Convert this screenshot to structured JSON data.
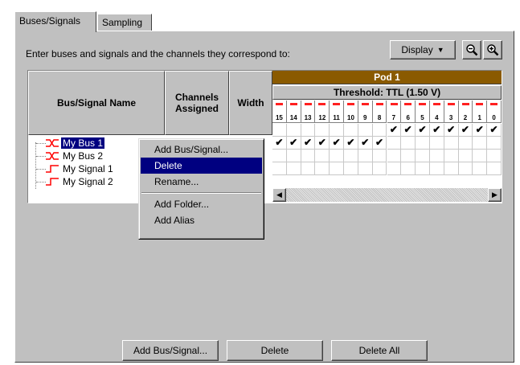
{
  "tabs": [
    {
      "label": "Buses/Signals",
      "active": true
    },
    {
      "label": "Sampling",
      "active": false
    }
  ],
  "instruction": "Enter buses and signals and the channels they correspond to:",
  "toolbar": {
    "display_label": "Display",
    "zoom_out_icon": "zoom-out-icon",
    "zoom_in_icon": "zoom-in-icon"
  },
  "grid": {
    "columns": {
      "name": "Bus/Signal Name",
      "channels": "Channels Assigned",
      "width": "Width"
    },
    "pod": {
      "label": "Pod 1",
      "threshold": "Threshold: TTL (1.50 V)",
      "channels": [
        "15",
        "14",
        "13",
        "12",
        "11",
        "10",
        "9",
        "8",
        "7",
        "6",
        "5",
        "4",
        "3",
        "2",
        "1",
        "0"
      ]
    },
    "rows": [
      {
        "name": "My Bus 1",
        "type": "bus",
        "selected": true,
        "assigned": [
          "7",
          "6",
          "5",
          "4",
          "3",
          "2",
          "1",
          "0"
        ]
      },
      {
        "name": "My Bus 2",
        "type": "bus",
        "selected": false,
        "assigned": [
          "15",
          "14",
          "13",
          "12",
          "11",
          "10",
          "9",
          "8"
        ]
      },
      {
        "name": "My Signal 1",
        "type": "signal",
        "selected": false,
        "assigned": []
      },
      {
        "name": "My Signal 2",
        "type": "signal",
        "selected": false,
        "assigned": []
      }
    ],
    "check_glyph": "✔"
  },
  "context_menu": {
    "items": [
      {
        "label": "Add Bus/Signal...",
        "highlighted": false
      },
      {
        "label": "Delete",
        "highlighted": true
      },
      {
        "label": "Rename...",
        "highlighted": false
      },
      {
        "separator": true
      },
      {
        "label": "Add Folder...",
        "highlighted": false
      },
      {
        "label": "Add Alias",
        "highlighted": false
      }
    ]
  },
  "buttons": {
    "add": "Add Bus/Signal...",
    "delete": "Delete",
    "delete_all": "Delete All"
  },
  "colors": {
    "pod_bar": "#8a5a00",
    "selection": "#000080",
    "threshold_dash": "#ff2020",
    "bus_icon": "#ff0000"
  }
}
